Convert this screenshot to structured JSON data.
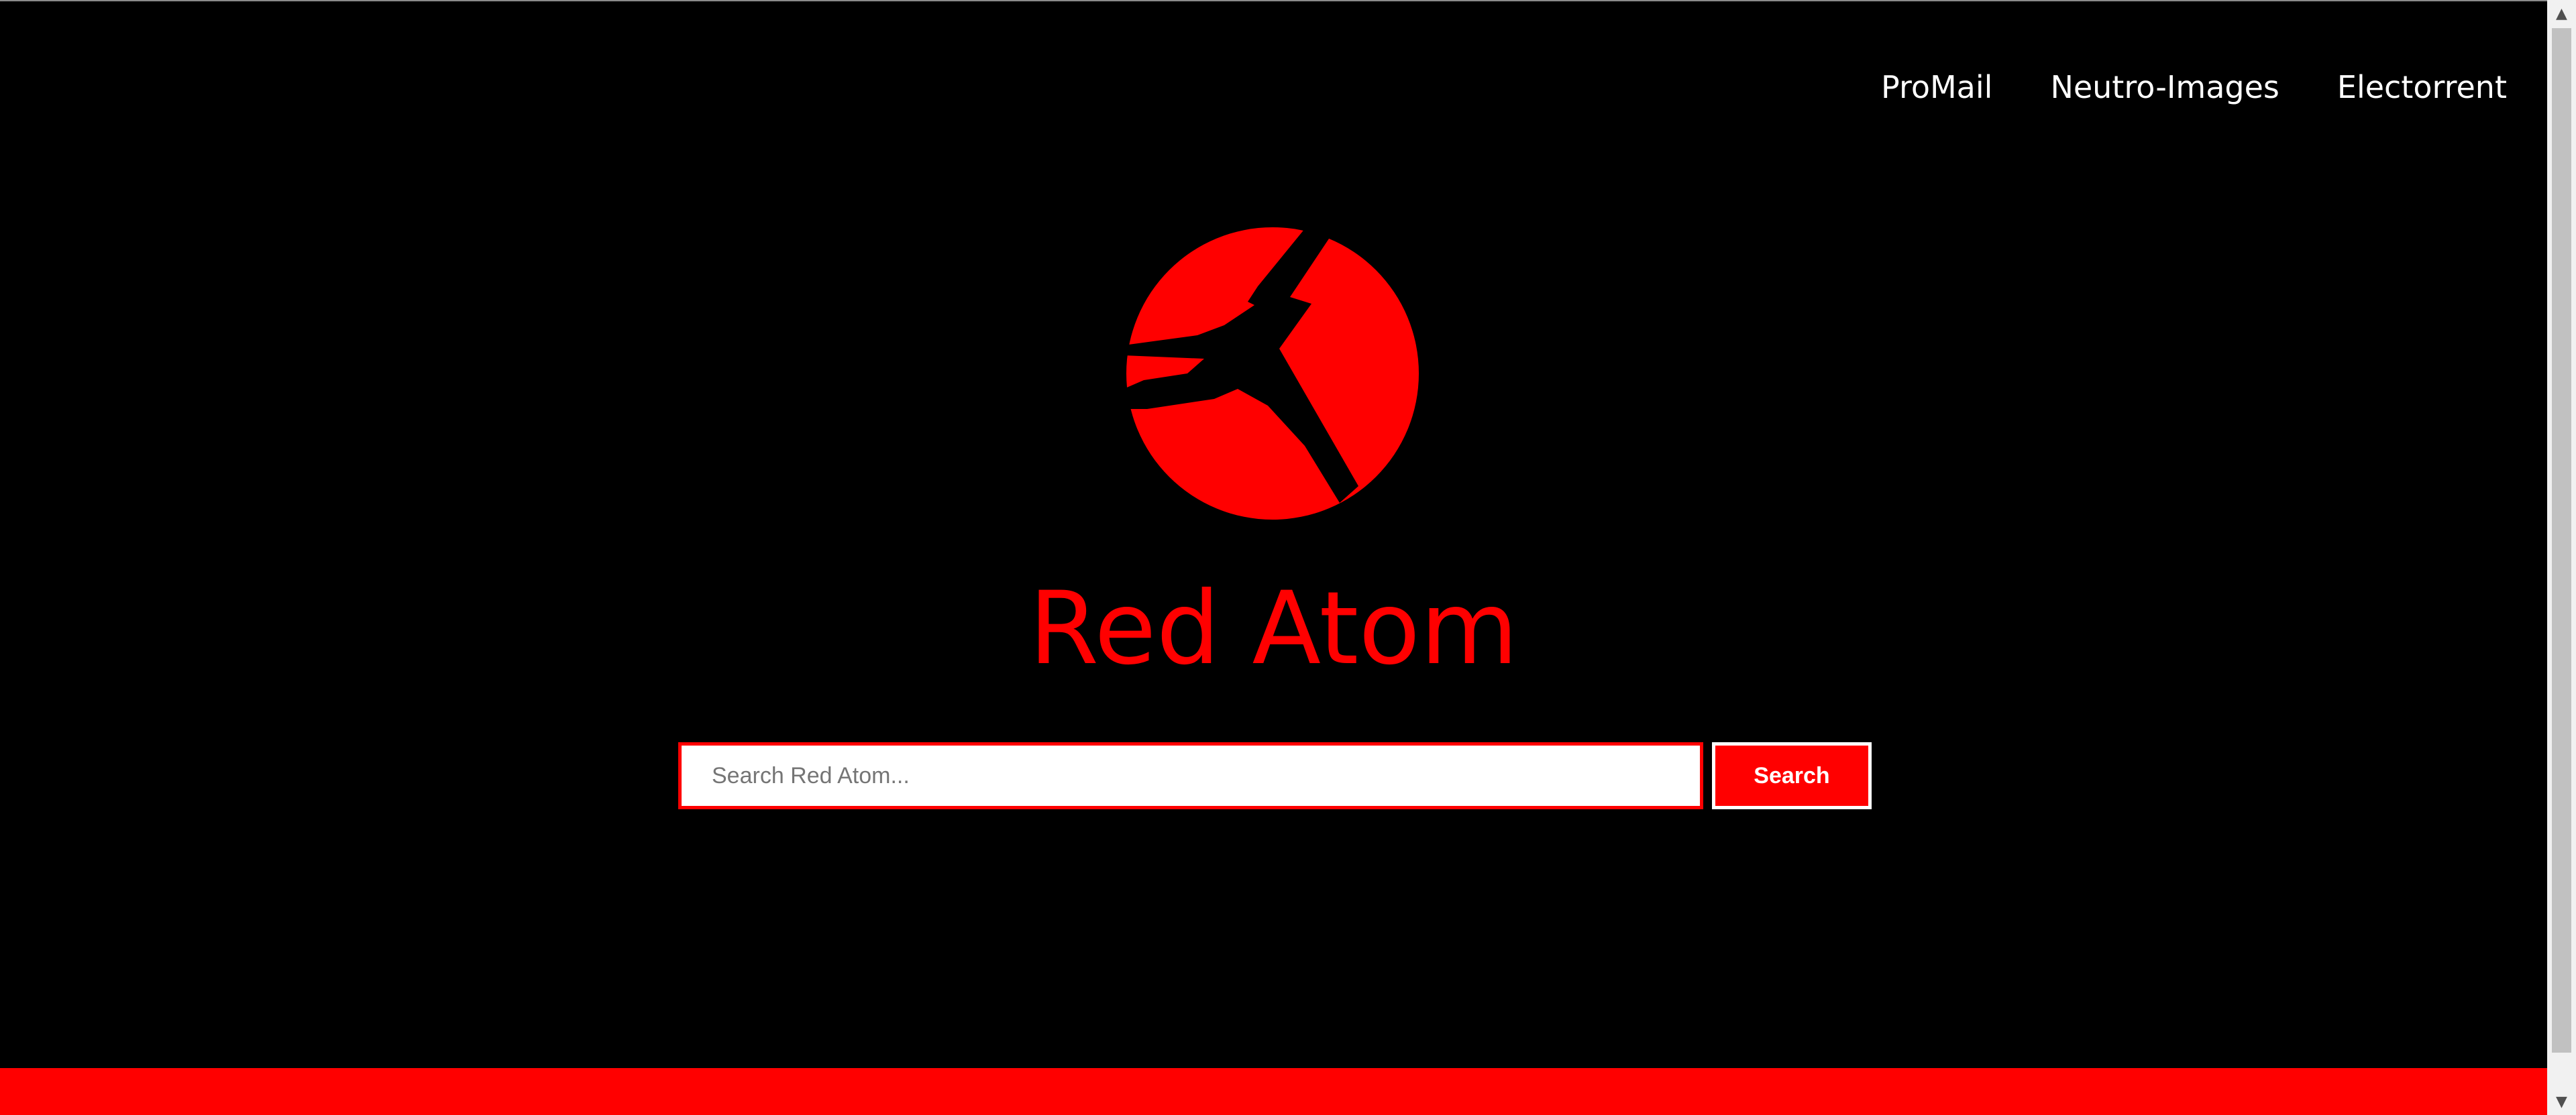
{
  "nav": {
    "items": [
      {
        "label": "ProMail"
      },
      {
        "label": "Neutro-Images"
      },
      {
        "label": "Electorrent"
      }
    ]
  },
  "brand": {
    "title": "Red Atom",
    "logo_icon": "red-atom-logo-icon"
  },
  "search": {
    "placeholder": "Search Red Atom...",
    "value": "",
    "button_label": "Search"
  },
  "colors": {
    "background": "#000000",
    "accent": "#ff0000",
    "nav_text": "#ffffff"
  },
  "scrollbar": {
    "up_arrow_icon": "scroll-up-arrow-icon",
    "down_arrow_icon": "scroll-down-arrow-icon"
  }
}
